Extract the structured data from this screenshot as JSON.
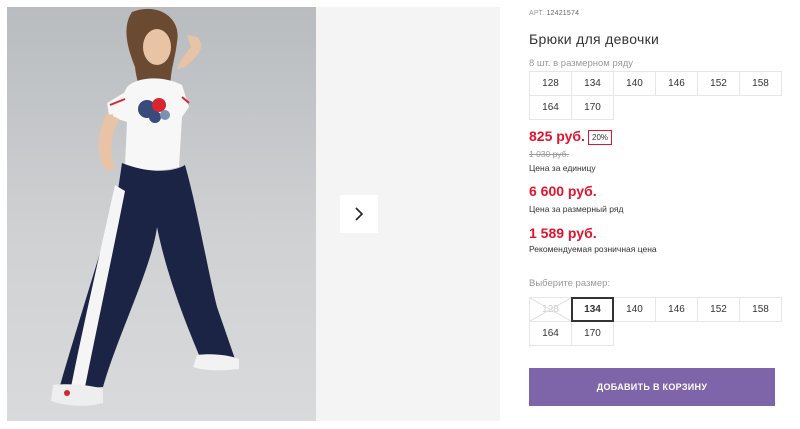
{
  "product": {
    "article_label": "АРТ.",
    "article_number": "12421574",
    "title": "Брюки для девочки",
    "pack_info": "8 шт. в размерном ряду"
  },
  "size_row": [
    {
      "label": "128"
    },
    {
      "label": "134"
    },
    {
      "label": "140"
    },
    {
      "label": "146"
    },
    {
      "label": "152"
    },
    {
      "label": "158"
    },
    {
      "label": "164"
    },
    {
      "label": "170"
    }
  ],
  "pricing": {
    "unit_price": "825 руб.",
    "discount": "20%",
    "old_price": "1 030 руб.",
    "unit_note": "Цена за единицу",
    "row_price": "6 600 руб.",
    "row_note": "Цена за размерный ряд",
    "retail_price": "1 589 руб.",
    "retail_note": "Рекомендуемая розничная цена"
  },
  "size_select": {
    "label": "Выберите размер:",
    "options": [
      {
        "label": "128",
        "state": "disabled"
      },
      {
        "label": "134",
        "state": "selected"
      },
      {
        "label": "140",
        "state": "normal"
      },
      {
        "label": "146",
        "state": "normal"
      },
      {
        "label": "152",
        "state": "normal"
      },
      {
        "label": "158",
        "state": "normal"
      },
      {
        "label": "164",
        "state": "normal"
      },
      {
        "label": "170",
        "state": "normal"
      }
    ]
  },
  "cart_button": "ДОБАВИТЬ В КОРЗИНУ",
  "icons": {
    "gallery_next": "chevron-right-icon"
  },
  "colors": {
    "accent_button": "#7e64a9",
    "price_red": "#e2132b"
  }
}
